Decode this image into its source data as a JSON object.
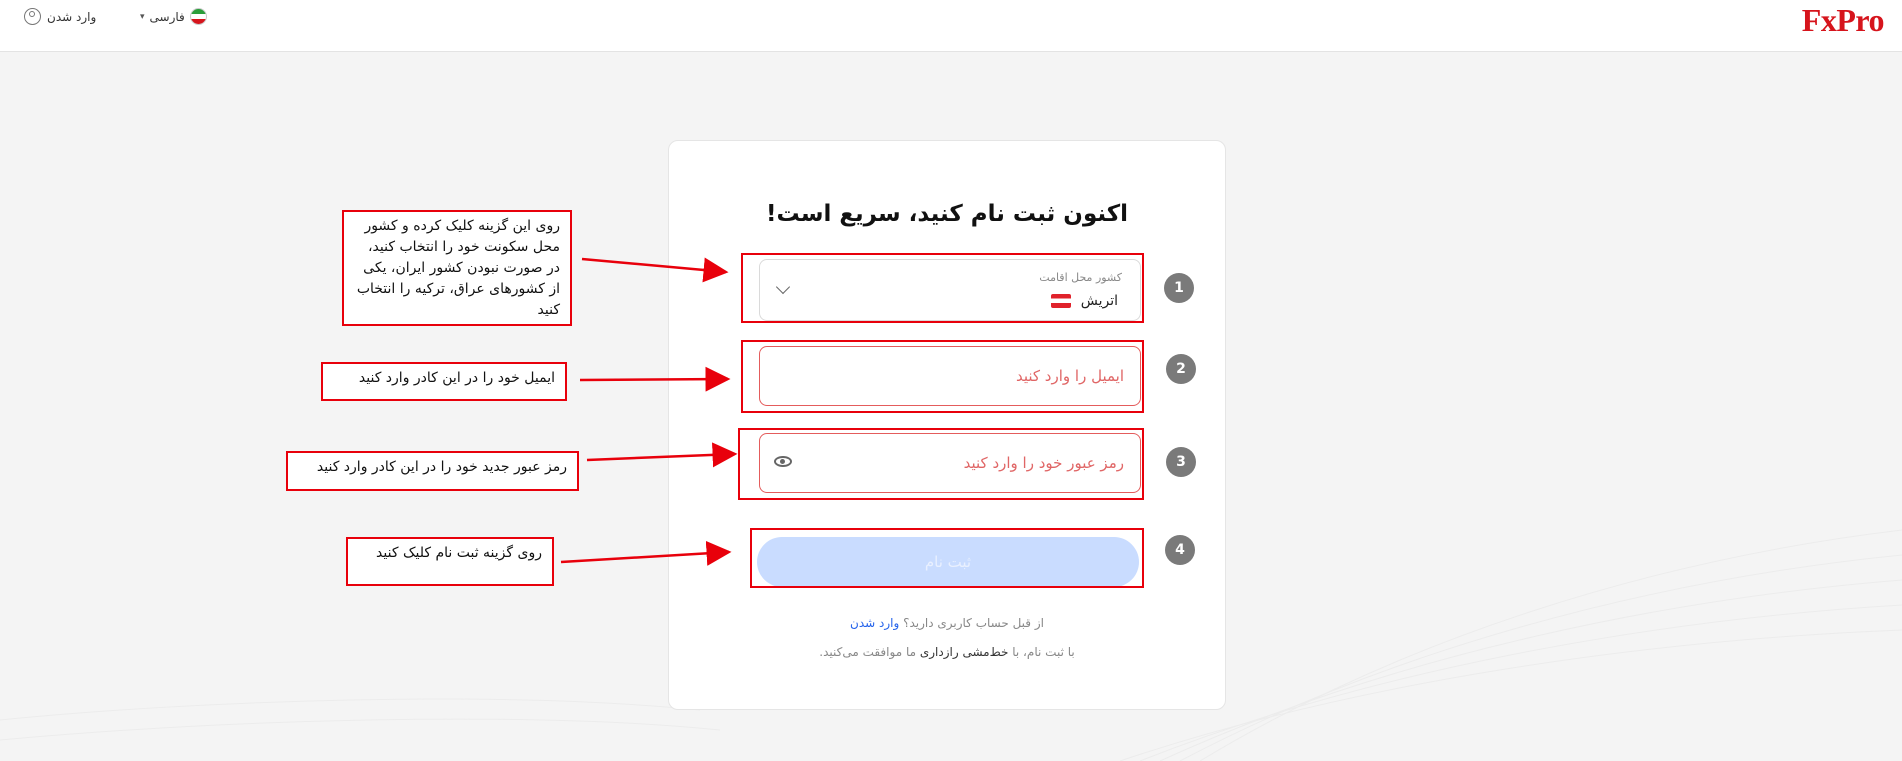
{
  "header": {
    "logo": "FxPro",
    "login_label": "وارد شدن",
    "language_label": "فارسی"
  },
  "form": {
    "title": "اکنون ثبت نام کنید، سریع است!",
    "country_label": "کشور محل اقامت",
    "country_value": "اتریش",
    "email_placeholder": "ایمیل را وارد کنید",
    "password_placeholder": "رمز عبور خود را وارد کنید",
    "submit_label": "ثبت نام",
    "have_account_text": "از قبل حساب کاربری دارید؟",
    "have_account_link": "وارد شدن",
    "terms_prefix": "با ثبت نام، با",
    "terms_link": "خط‌مشی رازداری",
    "terms_suffix": "ما موافقت می‌کنید."
  },
  "annotations": {
    "steps": [
      "1",
      "2",
      "3",
      "4"
    ],
    "callouts": [
      "روی این گزینه کلیک کرده و کشور محل سکونت خود را انتخاب کنید، در صورت نبودن کشور ایران، یکی از کشورهای عراق، ترکیه را انتخاب کنید",
      "ایمیل خود را در این کادر وارد کنید",
      "رمز عبور جدید خود را در این کادر وارد کنید",
      "روی گزینه ثبت نام کلیک کنید"
    ],
    "color": "#e8000b"
  },
  "colors": {
    "brand": "#d6141c",
    "link": "#2563eb",
    "submit_disabled": "#c9dcff",
    "error_border": "#e45c5c"
  }
}
